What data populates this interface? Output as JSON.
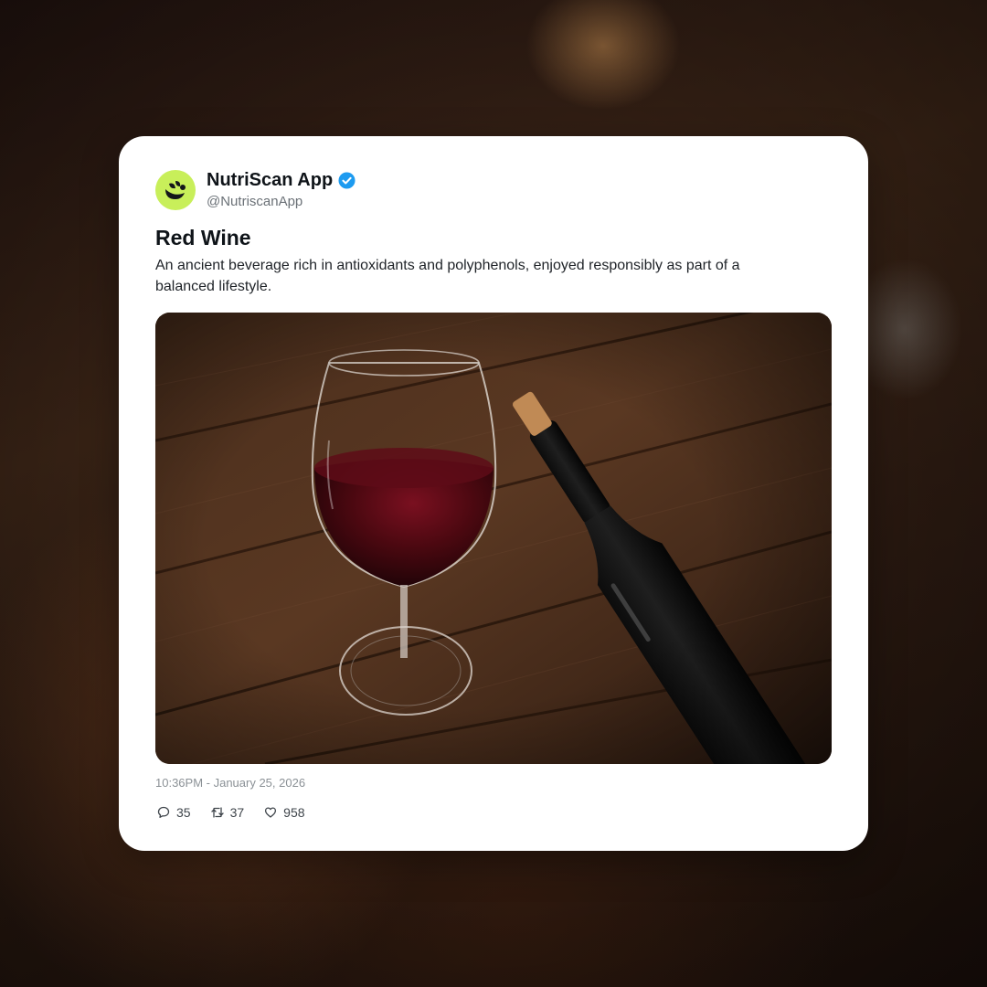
{
  "post": {
    "author": {
      "display_name": "NutriScan App",
      "handle": "@NutriscanApp",
      "verified": true,
      "avatar_color": "#c8ef5a",
      "avatar_icon": "leaf-logo-icon"
    },
    "title": "Red Wine",
    "body": "An ancient beverage rich in antioxidants and polyphenols, enjoyed responsibly as part of a balanced lifestyle.",
    "image_subject": "wine-glass-and-bottle-photo",
    "timestamp": "10:36PM - January 25, 2026",
    "stats": {
      "replies": "35",
      "reposts": "37",
      "likes": "958"
    }
  },
  "colors": {
    "verified_badge": "#1d9bf0",
    "card_background": "#ffffff",
    "text_primary": "#0f1419",
    "text_secondary": "#6b7177"
  }
}
